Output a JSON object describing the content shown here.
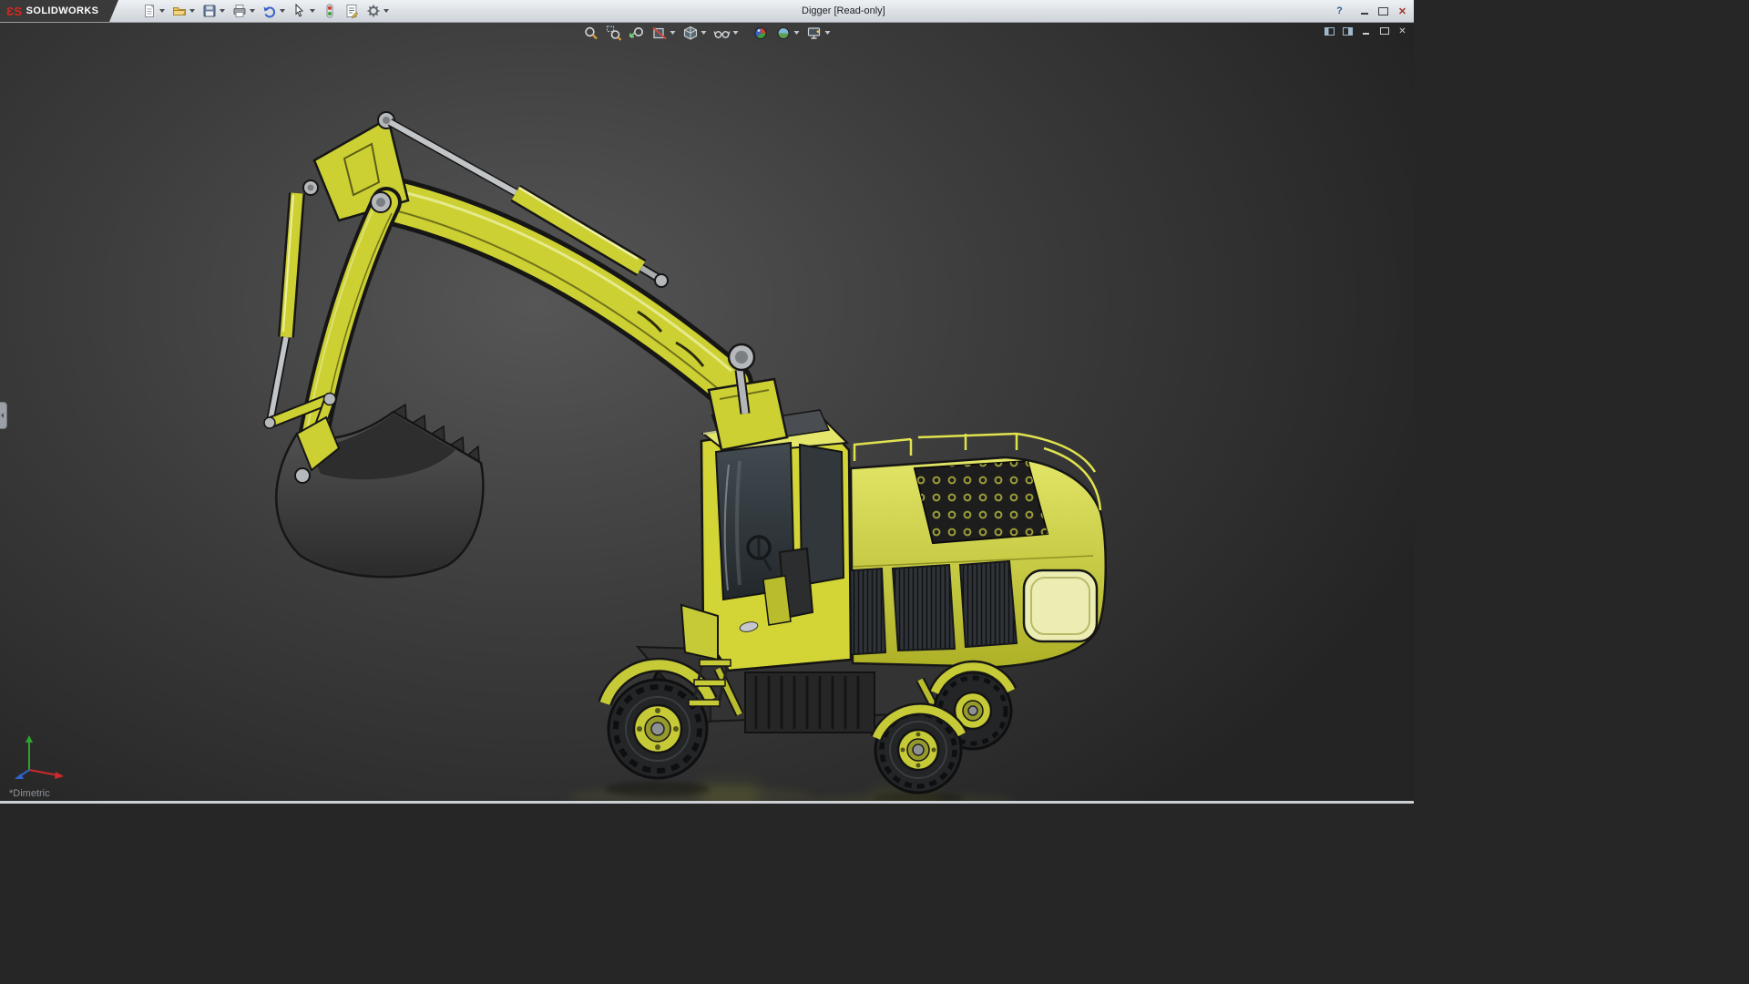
{
  "window": {
    "brand": "SOLIDWORKS",
    "logo_text": "ƐS",
    "title": "Digger [Read-only]",
    "controls": {
      "help": "?",
      "close": "✕"
    }
  },
  "toolbar": {
    "buttons": [
      {
        "name": "new-document",
        "caret": true
      },
      {
        "name": "open",
        "caret": true
      },
      {
        "name": "save",
        "caret": true
      },
      {
        "name": "print",
        "caret": true
      },
      {
        "name": "undo",
        "caret": true
      },
      {
        "name": "select",
        "caret": true
      },
      {
        "name": "rebuild",
        "caret": false
      },
      {
        "name": "file-properties",
        "caret": false
      },
      {
        "name": "options",
        "caret": true
      }
    ]
  },
  "heads_up_toolbar": {
    "buttons": [
      {
        "name": "zoom-to-fit",
        "caret": false
      },
      {
        "name": "zoom-to-area",
        "caret": false
      },
      {
        "name": "previous-view",
        "caret": false
      },
      {
        "name": "section-view",
        "caret": true
      },
      {
        "name": "display-style",
        "caret": true
      },
      {
        "name": "hide-show-items",
        "caret": true
      },
      {
        "name": "edit-appearance",
        "caret": false
      },
      {
        "name": "apply-scene",
        "caret": true
      },
      {
        "name": "view-settings",
        "caret": true
      }
    ]
  },
  "document_window_controls": [
    "pane-split-left",
    "pane-split-right",
    "minimize",
    "restore",
    "close"
  ],
  "viewport": {
    "view_orientation_label": "*Dimetric",
    "background_center": "#565656",
    "background_edge": "#242424"
  },
  "model": {
    "name": "Digger",
    "parts": [
      "boom",
      "boom-cylinder",
      "bucket-cylinder",
      "dipper-arm",
      "bucket-linkage",
      "bucket",
      "cab",
      "engine-housing",
      "handrails",
      "top-vent-panel",
      "side-grilles",
      "chassis",
      "wheels",
      "fenders",
      "ladder"
    ],
    "colors": {
      "body_yellow": "#ccd032",
      "body_yellow_light": "#e2e566",
      "outline": "#161616",
      "metal": "#b6b9bb",
      "bucket_gray": "#3c3c3c",
      "tire_black": "#232527",
      "glass": "#2e3539"
    }
  },
  "triad": {
    "axes": [
      {
        "name": "x-axis",
        "color": "#cc2a2a"
      },
      {
        "name": "y-axis",
        "color": "#2da42d"
      },
      {
        "name": "z-axis",
        "color": "#2f62cc"
      }
    ]
  }
}
